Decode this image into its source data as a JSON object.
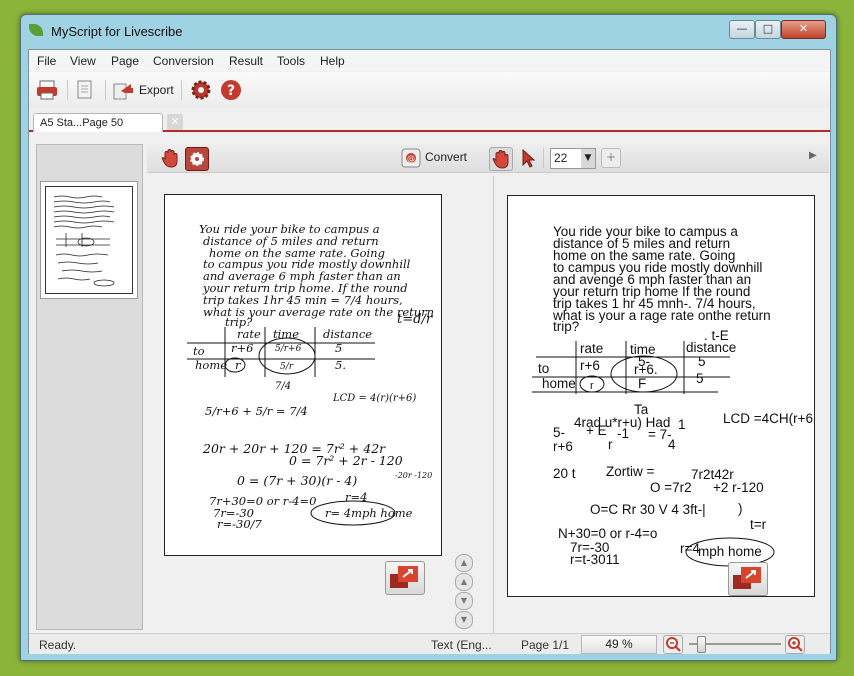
{
  "window": {
    "title": "MyScript for Livescribe",
    "minimize_glyph": "—",
    "maximize_glyph": "□",
    "close_glyph": "✕"
  },
  "menu": [
    "File",
    "View",
    "Page",
    "Conversion",
    "Result",
    "Tools",
    "Help"
  ],
  "toolbar": {
    "export_label": "Export"
  },
  "tab": {
    "label": "A5 Sta...Page 50",
    "close_glyph": "✕"
  },
  "right_toolbar": {
    "convert_label": "Convert",
    "zoom_value": "22",
    "plus_glyph": "+",
    "arrow_glyph": "▶"
  },
  "handwriting": [
    "You ride your bike to campus a",
    "distance of 5 miles and return",
    "home on the same rate. Going",
    "to campus you ride mostly downhill",
    "and average 6 mph faster than an",
    "your return trip home. If the round",
    "trip takes 1hr 45 min = 7/4 hours,",
    "what is your average rate on the return",
    "trip?",
    "t=d/r",
    "rate",
    "time",
    "distance",
    "to",
    "r+6",
    "5/r+6",
    "5",
    "home",
    "r",
    "5/r",
    "5.",
    "7/4",
    "5/r+6 + 5/r = 7/4",
    "LCD = 4(r)(r+6)",
    "20r + 20r + 120 = 7r² + 42r",
    "0 = 7r² + 2r - 120",
    "0 = (7r + 30)(r - 4)",
    "-20r -120",
    "7r+30=0   or   r-4=0",
    "7r=-30",
    "r=-30/7",
    "r=4",
    "r= 4mph home"
  ],
  "recognized": [
    "You ride your bike to campus a",
    "distance of 5 miles and return",
    "home on the same rate. Going",
    "to campus you ride mostly downhill",
    "and avenge 6 mph faster than an",
    "your return trip home If the round",
    "trip takes 1 hr 45 mnh-. 7/4 hours,",
    "what is your a rage rate onthe return",
    "trip?",
    ". t-E",
    "rate",
    "time",
    "distance",
    "to",
    "r+6",
    "r+6.",
    "5",
    "5-",
    "5",
    "home",
    "r",
    "F",
    "Ta",
    "4rad u*r+u) Had",
    "1",
    "LCD =4CH(r+6",
    "5-",
    "+ E",
    "-1",
    "= 7-",
    "r+6",
    "r",
    "4",
    "20 t",
    "Zortiw =",
    "7r2t42r",
    "O =7r2",
    "+2 r-120",
    "O=C Rr 30 V 4 3ft-|",
    ")",
    "t=r",
    "N+30=0 or r-4=o",
    "7r=-30",
    "r=t-3011",
    "r=4",
    "mph home"
  ],
  "status": {
    "ready": "Ready.",
    "language": "Text (Eng...",
    "page": "Page 1/1",
    "zoom": "49 %"
  }
}
